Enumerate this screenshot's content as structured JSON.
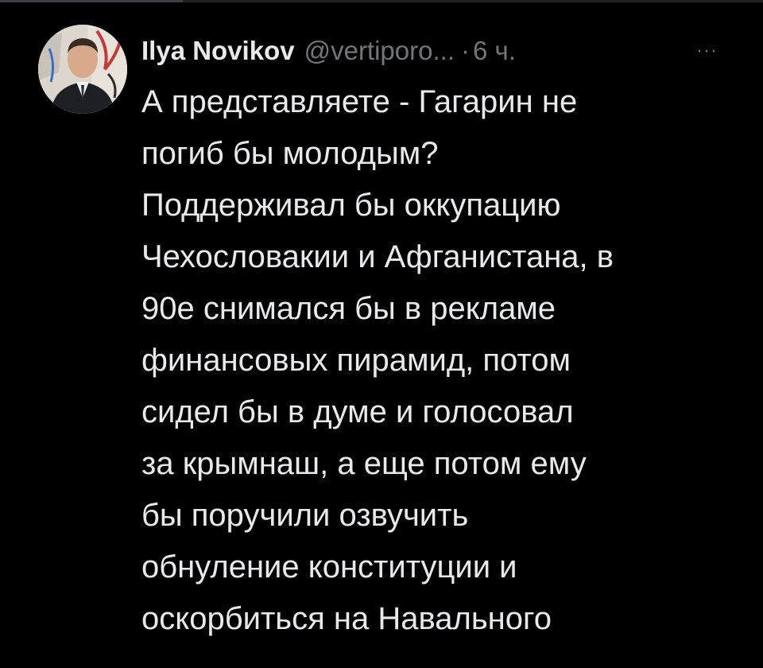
{
  "tweet": {
    "author": {
      "display_name": "Ilya Novikov",
      "handle": "@vertiporo...",
      "avatar_icon": "profile-photo"
    },
    "separator": "·",
    "time": "6 ч.",
    "more_icon": "more-horizontal-icon",
    "more_glyph": "···",
    "text_lines": [
      "А представляете - Гагарин не",
      "погиб бы молодым?",
      "Поддерживал бы оккупацию",
      "Чехословакии и Афганистана, в",
      "90е снимался бы в рекламе",
      "финансовых пирамид, потом",
      "сидел бы в думе и голосовал",
      "за крымнаш, а еще потом ему",
      "бы поручили озвучить",
      "обнуление конституции и",
      "оскорбиться на Навального"
    ]
  },
  "colors": {
    "background": "#000000",
    "primary_text": "#e7e9ea",
    "secondary_text": "#71767b"
  }
}
